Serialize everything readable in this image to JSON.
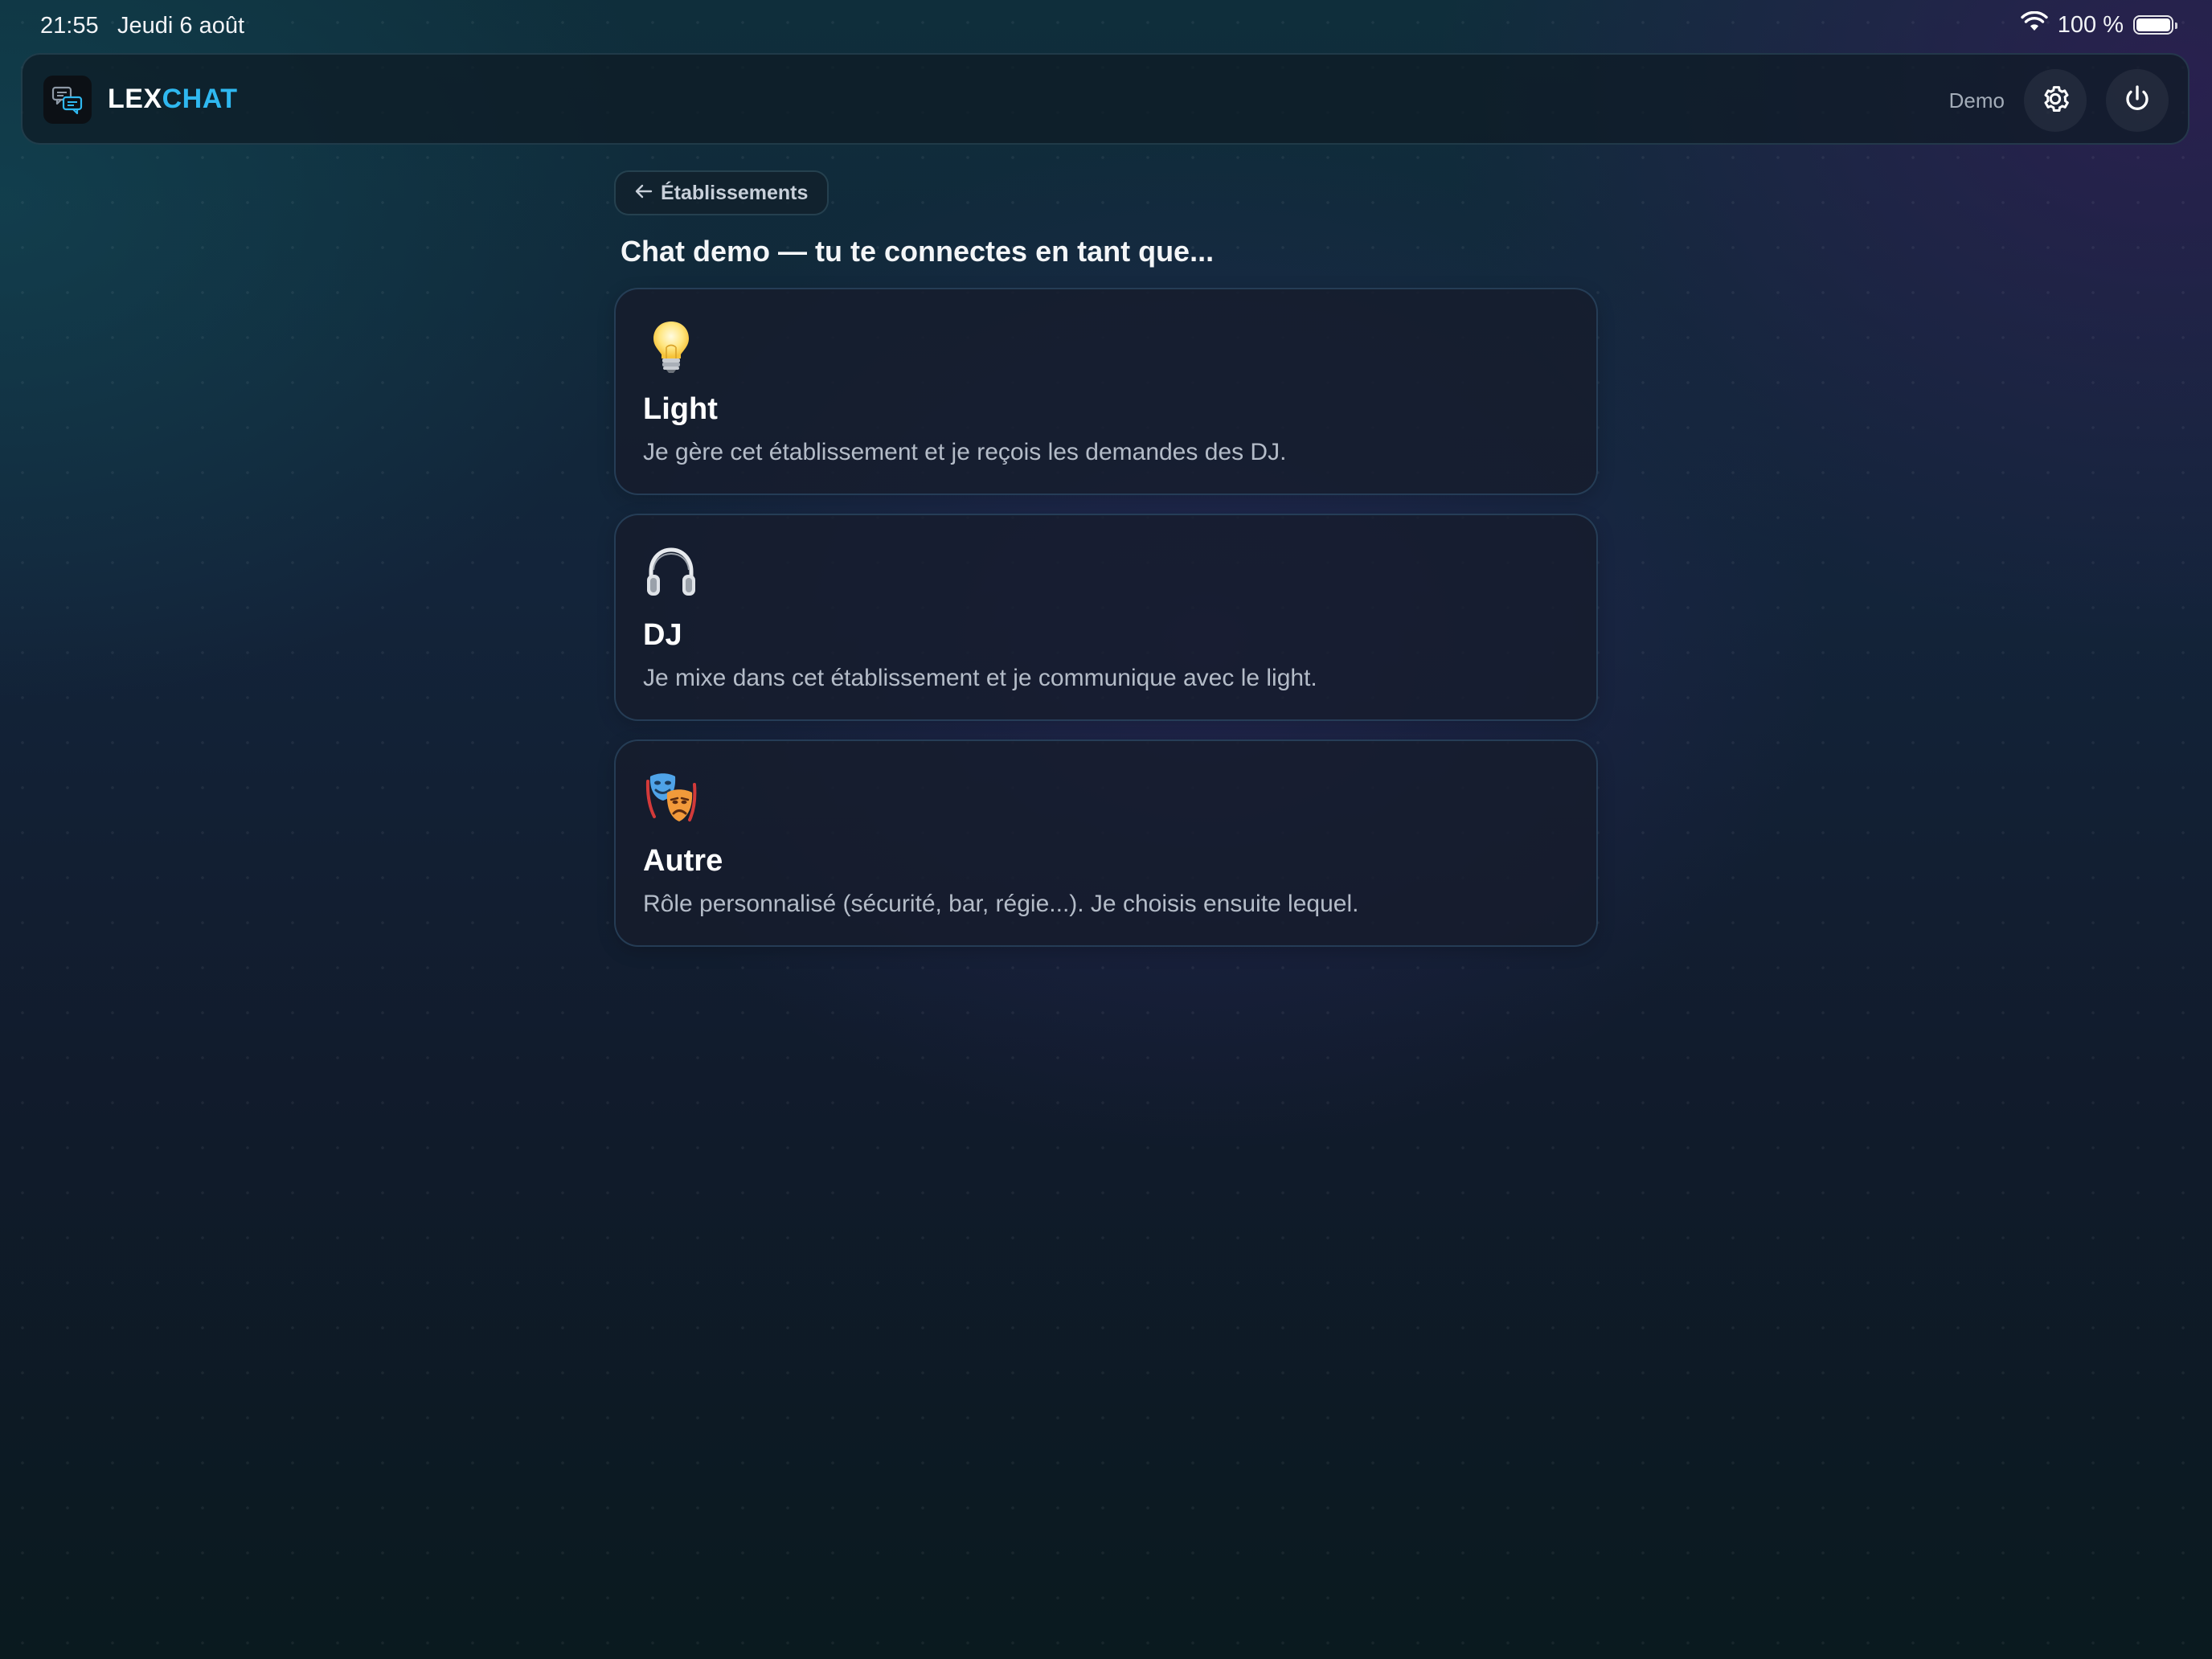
{
  "status_bar": {
    "time": "21:55",
    "date": "Jeudi 6 août",
    "battery": "100 %",
    "battery_level": 1.0
  },
  "header": {
    "app_name_part1": "LEX",
    "app_name_part2": "CHAT",
    "user_label": "Demo",
    "accent_color": "#2fb8f0",
    "logo_icon": "chat-bubbles-icon",
    "settings_icon": "gear-icon",
    "power_icon": "power-icon"
  },
  "navigation": {
    "back_label": "Établissements"
  },
  "page": {
    "title": "Chat demo — tu te connectes en tant que..."
  },
  "roles": [
    {
      "icon": "lightbulb-icon",
      "name": "Light",
      "description": "Je gère cet établissement et je reçois les demandes des DJ."
    },
    {
      "icon": "headphones-icon",
      "name": "DJ",
      "description": "Je mixe dans cet établissement et je communique avec le light."
    },
    {
      "icon": "theater-masks-icon",
      "name": "Autre",
      "description": "Rôle personnalisé (sécurité, bar, régie...). Je choisis ensuite lequel."
    }
  ]
}
